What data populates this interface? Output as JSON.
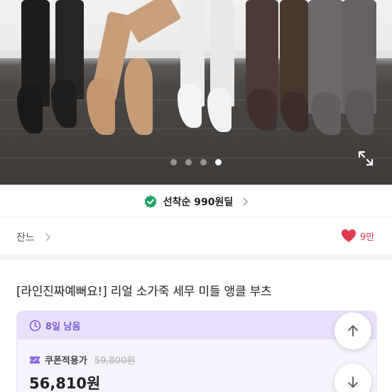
{
  "gallery": {
    "image_count": 4,
    "active_index": 3,
    "expand_icon": "expand-icon"
  },
  "deal_banner": {
    "icon": "verified-check-icon",
    "text": "선착순 990원딜",
    "chevron": "chevron-right-icon",
    "accent_color": "#1fa463"
  },
  "store": {
    "name": "잔느",
    "chevron": ">",
    "likes": "9만",
    "heart_color": "#e13a4e"
  },
  "product": {
    "title": "[라인진짜예뻐요!] 리얼 소가죽 세무 미들 앵클 부츠"
  },
  "price_card": {
    "timer": "8일 남음",
    "coupon_label": "쿠폰적용가",
    "original_price": "59,800원",
    "sale_price": "56,810원",
    "accent_color": "#7a5bd8"
  },
  "scroll_buttons": {
    "up_icon": "arrow-up-icon",
    "down_icon": "arrow-down-icon"
  }
}
